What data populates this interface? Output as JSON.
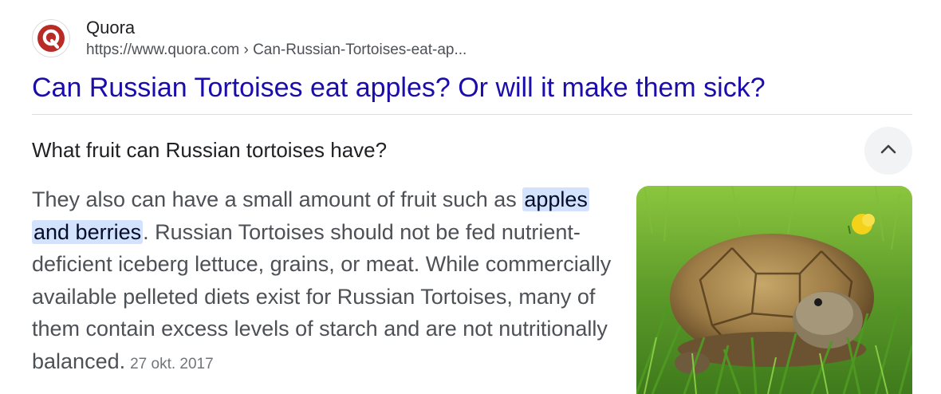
{
  "source": {
    "name": "Quora",
    "url": "https://www.quora.com › Can-Russian-Tortoises-eat-ap...",
    "favicon": "quora-logo-icon",
    "brand_color": "#b92b27"
  },
  "result": {
    "title": "Can Russian Tortoises eat apples? Or will it make them sick?",
    "title_color": "#1a0dab"
  },
  "snippet": {
    "question": "What fruit can Russian tortoises have?",
    "toggle_icon": "chevron-up-icon",
    "answer_prefix": "They also can have a small amount of fruit such as ",
    "highlight_1": "apples",
    "highlight_2": "and berries",
    "answer_rest": ". Russian Tortoises should not be fed nutrient-deficient iceberg lettuce, grains, or meat. While commercially available pelleted diets exist for Russian Tortoises, many of them contain excess levels of starch and are not nutritionally balanced.",
    "date": "27 okt. 2017",
    "highlight_color": "#d3e3fd"
  }
}
